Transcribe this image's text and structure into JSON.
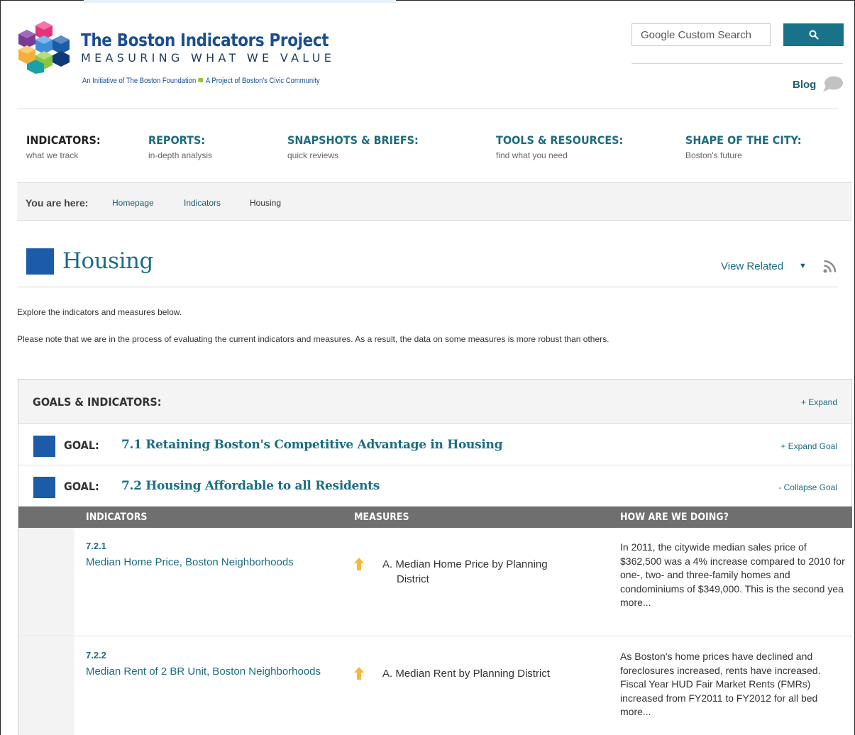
{
  "header": {
    "brand_title": "The Boston Indicators Project",
    "brand_tagline": "MEASURING WHAT WE VALUE",
    "brand_sub_left": "An Initiative of The Boston Foundation",
    "brand_sub_right": "A Project of Boston's Civic Community",
    "search_placeholder": "Google Custom Search",
    "blog_label": "Blog"
  },
  "nav": [
    {
      "title": "INDICATORS:",
      "sub": "what we track"
    },
    {
      "title": "REPORTS:",
      "sub": "in-depth analysis"
    },
    {
      "title": "SNAPSHOTS & BRIEFS:",
      "sub": "quick reviews"
    },
    {
      "title": "TOOLS & RESOURCES:",
      "sub": "find what you need"
    },
    {
      "title": "SHAPE OF THE CITY:",
      "sub": "Boston's future"
    }
  ],
  "breadcrumb": {
    "label": "You are here:",
    "links": [
      "Homepage",
      "Indicators"
    ],
    "current": "Housing"
  },
  "page": {
    "title": "Housing",
    "view_related": "View Related",
    "caret": "▼",
    "intro_1": "Explore the indicators and measures below.",
    "intro_2": "Please note that we are in the process of evaluating the current indicators and measures.  As a result, the data on some measures is more robust than others."
  },
  "goals": {
    "heading": "GOALS & INDICATORS:",
    "expand_all": "+ Expand",
    "items": [
      {
        "label": "GOAL:",
        "title": "7.1 Retaining Boston's Competitive Advantage in Housing",
        "toggle": "+ Expand Goal"
      },
      {
        "label": "GOAL:",
        "title": "7.2 Housing Affordable to all Residents",
        "toggle": "- Collapse Goal"
      }
    ]
  },
  "table": {
    "columns": [
      "INDICATORS",
      "MEASURES",
      "HOW ARE WE DOING?"
    ],
    "rows": [
      {
        "number": "7.2.1",
        "name": "Median Home Price, Boston Neighborhoods",
        "trend": "arrow-up",
        "measure": "A. Median Home Price by Planning District",
        "how": "In 2011, the citywide median sales price of $362,500 was a 4% increase compared to 2010 for one-, two- and three-family homes and condominiums of $349,000. This is the second yea more..."
      },
      {
        "number": "7.2.2",
        "name": "Median Rent of 2 BR Unit, Boston Neighborhoods",
        "trend": "arrow-up",
        "measure": "A. Median Rent by Planning District",
        "how": "As Boston's home prices have declined and foreclosures increased, rents have increased. Fiscal Year HUD Fair Market Rents (FMRs) increased from FY2011 to FY2012 for all bed more..."
      }
    ]
  },
  "colors": {
    "accent_teal": "#1d6b80",
    "goal_blue": "#1b5ba8",
    "search_button": "#17728a",
    "table_header": "#6f6f6f",
    "trend_arrow": "#f5b93d"
  }
}
